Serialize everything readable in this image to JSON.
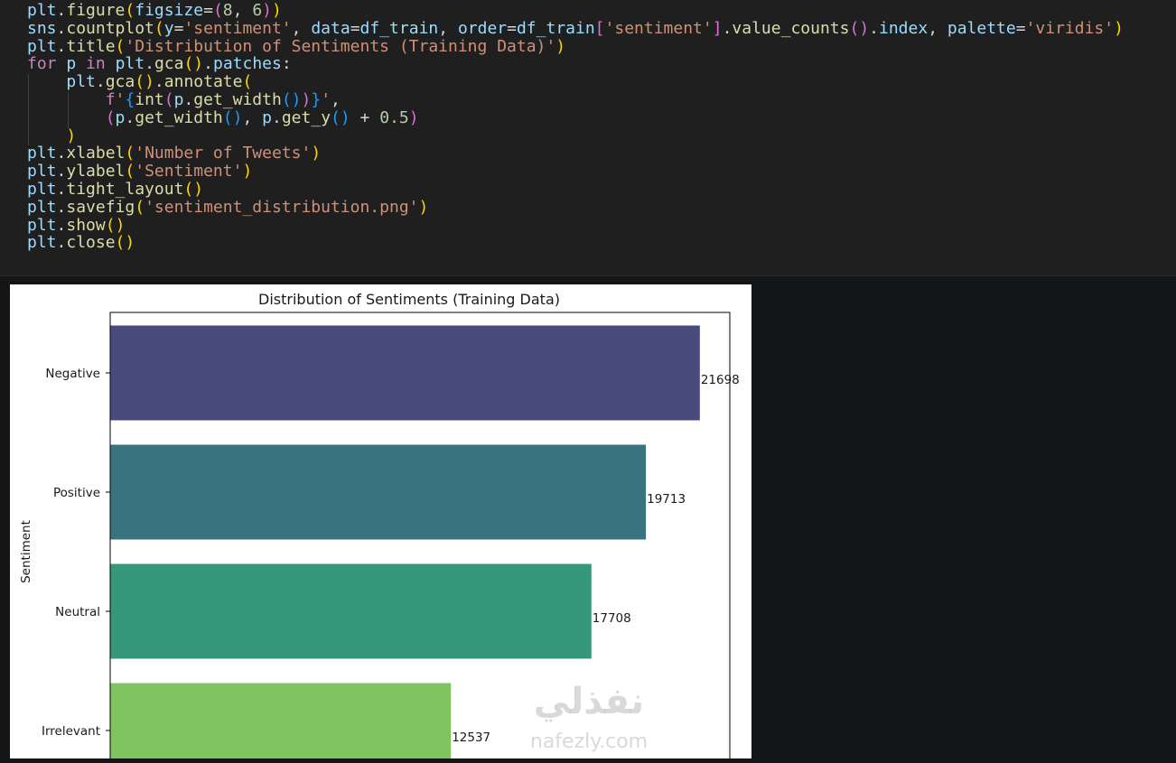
{
  "code_cell": {
    "lines": [
      [
        [
          "plt",
          "tk-id"
        ],
        [
          ".",
          "tk-plain"
        ],
        [
          "figure",
          "tk-fn"
        ],
        [
          "(",
          "tk-p1"
        ],
        [
          "figsize",
          "tk-param"
        ],
        [
          "=",
          "tk-plain"
        ],
        [
          "(",
          "tk-p2"
        ],
        [
          "8",
          "tk-num"
        ],
        [
          ", ",
          "tk-plain"
        ],
        [
          "6",
          "tk-num"
        ],
        [
          ")",
          "tk-p2"
        ],
        [
          ")",
          "tk-p1"
        ]
      ],
      [
        [
          "sns",
          "tk-id"
        ],
        [
          ".",
          "tk-plain"
        ],
        [
          "countplot",
          "tk-fn"
        ],
        [
          "(",
          "tk-p1"
        ],
        [
          "y",
          "tk-param"
        ],
        [
          "=",
          "tk-plain"
        ],
        [
          "'sentiment'",
          "tk-str"
        ],
        [
          ", ",
          "tk-plain"
        ],
        [
          "data",
          "tk-param"
        ],
        [
          "=",
          "tk-plain"
        ],
        [
          "df_train",
          "tk-id"
        ],
        [
          ", ",
          "tk-plain"
        ],
        [
          "order",
          "tk-param"
        ],
        [
          "=",
          "tk-plain"
        ],
        [
          "df_train",
          "tk-id"
        ],
        [
          "[",
          "tk-p2"
        ],
        [
          "'sentiment'",
          "tk-str"
        ],
        [
          "]",
          "tk-p2"
        ],
        [
          ".",
          "tk-plain"
        ],
        [
          "value_counts",
          "tk-fn"
        ],
        [
          "(",
          "tk-p2"
        ],
        [
          ")",
          "tk-p2"
        ],
        [
          ".",
          "tk-plain"
        ],
        [
          "index",
          "tk-id"
        ],
        [
          ", ",
          "tk-plain"
        ],
        [
          "palette",
          "tk-param"
        ],
        [
          "=",
          "tk-plain"
        ],
        [
          "'viridis'",
          "tk-str"
        ],
        [
          ")",
          "tk-p1"
        ]
      ],
      [
        [
          "plt",
          "tk-id"
        ],
        [
          ".",
          "tk-plain"
        ],
        [
          "title",
          "tk-fn"
        ],
        [
          "(",
          "tk-p1"
        ],
        [
          "'Distribution of Sentiments (Training Data)'",
          "tk-str"
        ],
        [
          ")",
          "tk-p1"
        ]
      ],
      [
        [
          "for",
          "tk-kw"
        ],
        [
          " ",
          "tk-plain"
        ],
        [
          "p",
          "tk-id"
        ],
        [
          " ",
          "tk-plain"
        ],
        [
          "in",
          "tk-kw"
        ],
        [
          " ",
          "tk-plain"
        ],
        [
          "plt",
          "tk-id"
        ],
        [
          ".",
          "tk-plain"
        ],
        [
          "gca",
          "tk-fn"
        ],
        [
          "(",
          "tk-p1"
        ],
        [
          ")",
          "tk-p1"
        ],
        [
          ".",
          "tk-plain"
        ],
        [
          "patches",
          "tk-id"
        ],
        [
          ":",
          "tk-plain"
        ]
      ],
      [
        [
          "    ",
          "tk-plain"
        ],
        [
          "plt",
          "tk-id"
        ],
        [
          ".",
          "tk-plain"
        ],
        [
          "gca",
          "tk-fn"
        ],
        [
          "(",
          "tk-p1"
        ],
        [
          ")",
          "tk-p1"
        ],
        [
          ".",
          "tk-plain"
        ],
        [
          "annotate",
          "tk-fn"
        ],
        [
          "(",
          "tk-p1"
        ]
      ],
      [
        [
          "        ",
          "tk-plain"
        ],
        [
          "f",
          "tk-kw"
        ],
        [
          "'",
          "tk-str"
        ],
        [
          "{",
          "tk-p3"
        ],
        [
          "int",
          "tk-fn"
        ],
        [
          "(",
          "tk-p2"
        ],
        [
          "p",
          "tk-id"
        ],
        [
          ".",
          "tk-plain"
        ],
        [
          "get_width",
          "tk-fn"
        ],
        [
          "(",
          "tk-p3"
        ],
        [
          ")",
          "tk-p3"
        ],
        [
          ")",
          "tk-p2"
        ],
        [
          "}",
          "tk-p3"
        ],
        [
          "'",
          "tk-str"
        ],
        [
          ",",
          "tk-plain"
        ]
      ],
      [
        [
          "        ",
          "tk-plain"
        ],
        [
          "(",
          "tk-p2"
        ],
        [
          "p",
          "tk-id"
        ],
        [
          ".",
          "tk-plain"
        ],
        [
          "get_width",
          "tk-fn"
        ],
        [
          "(",
          "tk-p3"
        ],
        [
          ")",
          "tk-p3"
        ],
        [
          ", ",
          "tk-plain"
        ],
        [
          "p",
          "tk-id"
        ],
        [
          ".",
          "tk-plain"
        ],
        [
          "get_y",
          "tk-fn"
        ],
        [
          "(",
          "tk-p3"
        ],
        [
          ")",
          "tk-p3"
        ],
        [
          " + ",
          "tk-plain"
        ],
        [
          "0.5",
          "tk-num"
        ],
        [
          ")",
          "tk-p2"
        ]
      ],
      [
        [
          "    ",
          "tk-plain"
        ],
        [
          ")",
          "tk-p1"
        ]
      ],
      [
        [
          "plt",
          "tk-id"
        ],
        [
          ".",
          "tk-plain"
        ],
        [
          "xlabel",
          "tk-fn"
        ],
        [
          "(",
          "tk-p1"
        ],
        [
          "'Number of Tweets'",
          "tk-str"
        ],
        [
          ")",
          "tk-p1"
        ]
      ],
      [
        [
          "plt",
          "tk-id"
        ],
        [
          ".",
          "tk-plain"
        ],
        [
          "ylabel",
          "tk-fn"
        ],
        [
          "(",
          "tk-p1"
        ],
        [
          "'Sentiment'",
          "tk-str"
        ],
        [
          ")",
          "tk-p1"
        ]
      ],
      [
        [
          "plt",
          "tk-id"
        ],
        [
          ".",
          "tk-plain"
        ],
        [
          "tight_layout",
          "tk-fn"
        ],
        [
          "(",
          "tk-p1"
        ],
        [
          ")",
          "tk-p1"
        ]
      ],
      [
        [
          "plt",
          "tk-id"
        ],
        [
          ".",
          "tk-plain"
        ],
        [
          "savefig",
          "tk-fn"
        ],
        [
          "(",
          "tk-p1"
        ],
        [
          "'sentiment_distribution.png'",
          "tk-str"
        ],
        [
          ")",
          "tk-p1"
        ]
      ],
      [
        [
          "plt",
          "tk-id"
        ],
        [
          ".",
          "tk-plain"
        ],
        [
          "show",
          "tk-fn"
        ],
        [
          "(",
          "tk-p1"
        ],
        [
          ")",
          "tk-p1"
        ]
      ],
      [
        [
          "plt",
          "tk-id"
        ],
        [
          ".",
          "tk-plain"
        ],
        [
          "close",
          "tk-fn"
        ],
        [
          "(",
          "tk-p1"
        ],
        [
          ")",
          "tk-p1"
        ]
      ]
    ]
  },
  "colors": {
    "editor_bg": "#1f1f1f",
    "output_bg": "#141516",
    "bar_negative": "#4a4b7d",
    "bar_positive": "#3a7380",
    "bar_neutral": "#35987b",
    "bar_irrelevant": "#80c45f"
  },
  "chart_data": {
    "type": "bar",
    "orientation": "horizontal",
    "title": "Distribution of Sentiments (Training Data)",
    "ylabel": "Sentiment",
    "categories": [
      "Negative",
      "Positive",
      "Neutral",
      "Irrelevant"
    ],
    "values": [
      21698,
      19713,
      17708,
      12537
    ],
    "data_labels": [
      "21698",
      "19713",
      "17708",
      "12537"
    ],
    "xlim": [
      0,
      22800
    ],
    "grid": false,
    "legend": "none"
  },
  "watermark": {
    "arabic": "نفذلي",
    "latin": "nafezly.com"
  }
}
